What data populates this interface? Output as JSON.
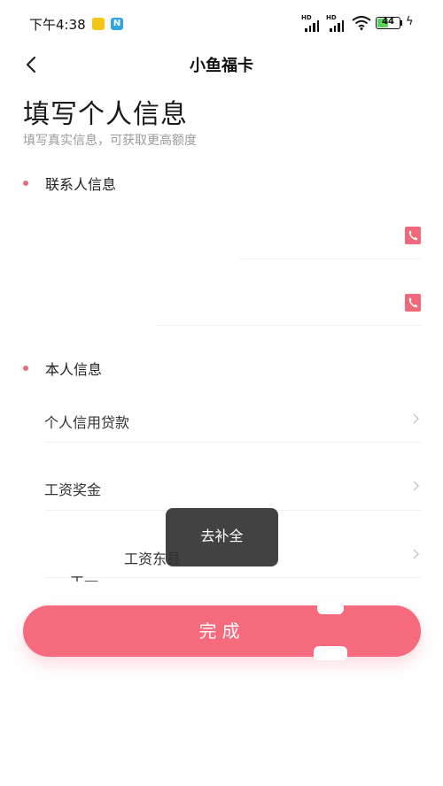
{
  "status_bar": {
    "time": "下午4:38",
    "battery_level": "44",
    "signal_label_1": "HD",
    "signal_label_2": "HD",
    "notif_icon_2": "N"
  },
  "nav": {
    "title": "小鱼福卡",
    "back_icon": "chevron-left-icon"
  },
  "header": {
    "title": "填写个人信息",
    "subtitle": "填写真实信息，可获取更高额度"
  },
  "contact_section": {
    "label": "联系人信息",
    "phone_icon": "phone-book-icon"
  },
  "self_section": {
    "label": "本人信息",
    "rows": [
      {
        "label": "个人信用贷款"
      },
      {
        "label": "工资奖金"
      },
      {
        "label": "工资东县"
      }
    ],
    "fragment_text": "工一"
  },
  "toast": {
    "text": "去补全"
  },
  "submit": {
    "label": "完成"
  },
  "colors": {
    "accent": "#f56b7d",
    "dot": "#f0697a",
    "toast_bg": "#323232"
  }
}
